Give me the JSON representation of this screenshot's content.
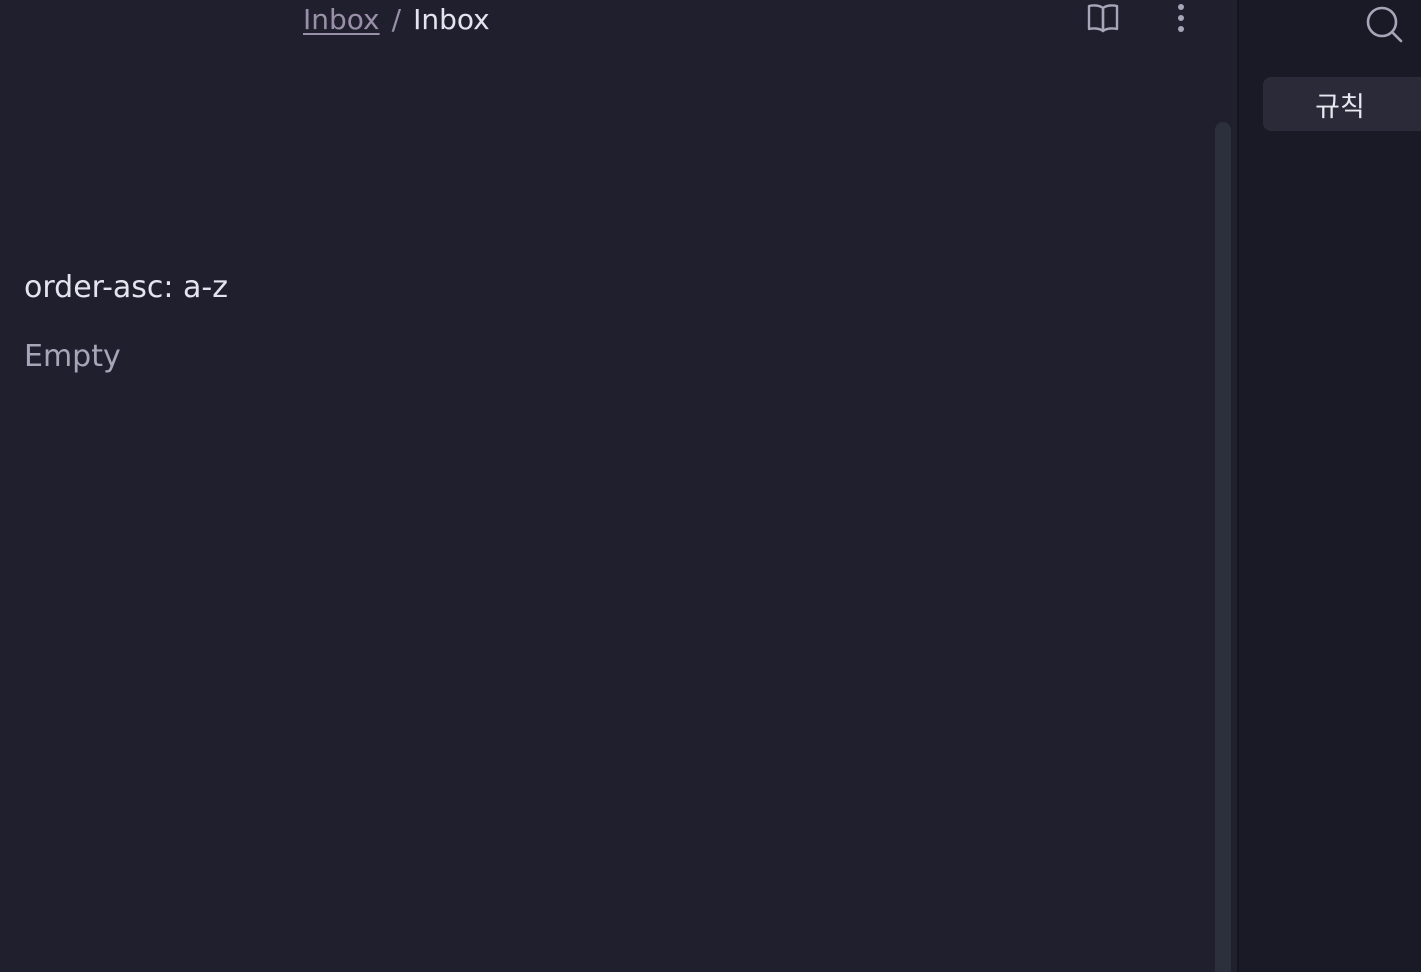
{
  "header": {
    "breadcrumb_parent": "Inbox",
    "breadcrumb_separator": "/",
    "breadcrumb_current": "Inbox",
    "icons": [
      "book-open-icon",
      "more-vertical-icon"
    ]
  },
  "content": {
    "line": "order-asc: a-z",
    "empty_text": "Empty"
  },
  "sidebar": {
    "search_icon": "search-icon",
    "tab_label": "규칙"
  },
  "colors": {
    "background": "#1f1f2e",
    "sidebar_background": "#1a1a26",
    "text_primary": "#e4e4ef",
    "text_muted": "#a7a5b8",
    "link": "#9a8fa8",
    "tab_background": "#2a2a38",
    "scrollbar": "#2c2f3c"
  }
}
